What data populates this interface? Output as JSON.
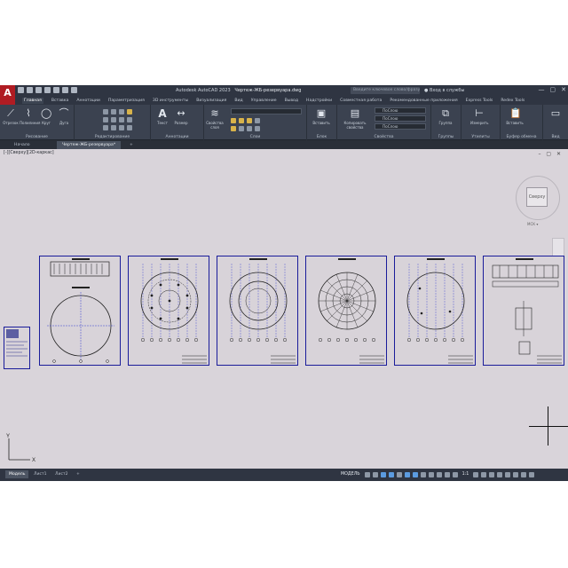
{
  "window": {
    "logo_letter": "A",
    "app_title": "Autodesk AutoCAD 2023",
    "file_title": "Чертеж-ЖБ-резервуара.dwg",
    "search_placeholder": "Введите ключевое слово/фразу",
    "user_label": "Вход в службы",
    "controls": [
      "—",
      "▢",
      "✕"
    ]
  },
  "ribbon_tabs": [
    "Главная",
    "Вставка",
    "Аннотации",
    "Параметризация",
    "3D инструменты",
    "Визуализация",
    "Вид",
    "Управление",
    "Вывод",
    "Надстройки",
    "Совместная работа",
    "Рекомендованные приложения",
    "Express Tools",
    "Redex Tools"
  ],
  "active_tab_index": 0,
  "ribbon": {
    "draw": {
      "label": "Рисование",
      "tools": [
        "Отрезок",
        "Полилиния",
        "Круг",
        "Дуга"
      ]
    },
    "modify": {
      "label": "Редактирование"
    },
    "annotation": {
      "label": "Аннотации",
      "tools": [
        "Текст",
        "Размер"
      ]
    },
    "layers": {
      "label": "Слои",
      "tool": "Свойства слоя"
    },
    "block": {
      "label": "Блок",
      "tool": "Вставить"
    },
    "properties": {
      "label": "Свойства",
      "tool": "Копировать свойства",
      "bylayer": [
        "ПоСлою",
        "ПоСлою",
        "ПоСлою"
      ]
    },
    "groups": {
      "label": "Группы",
      "tool": "Группа"
    },
    "utilities": {
      "label": "Утилиты",
      "tool": "Измерить"
    },
    "clipboard": {
      "label": "Буфер обмена",
      "tool": "Вставить"
    },
    "view": {
      "label": "Вид"
    }
  },
  "doc_tabs": [
    "Начало",
    "Чертеж-ЖБ-резервуара*",
    "+"
  ],
  "viewport_label": "[-][Сверху][2D-каркас]",
  "canvas_controls": "– ▢ ✕",
  "viewcube": {
    "face": "Сверху",
    "ucs": "МСК ▾"
  },
  "ucs_axes": {
    "x": "X",
    "y": "Y"
  },
  "layout_tabs": [
    "Модель",
    "Лист1",
    "Лист2",
    "+"
  ],
  "status": {
    "model_label": "МОДЕЛЬ",
    "scale": "1:1"
  },
  "colors": {
    "sheet_border": "#1a1c9a",
    "canvas": "#d9d4da",
    "ribbon": "#3b4250",
    "logo": "#b01c23"
  }
}
